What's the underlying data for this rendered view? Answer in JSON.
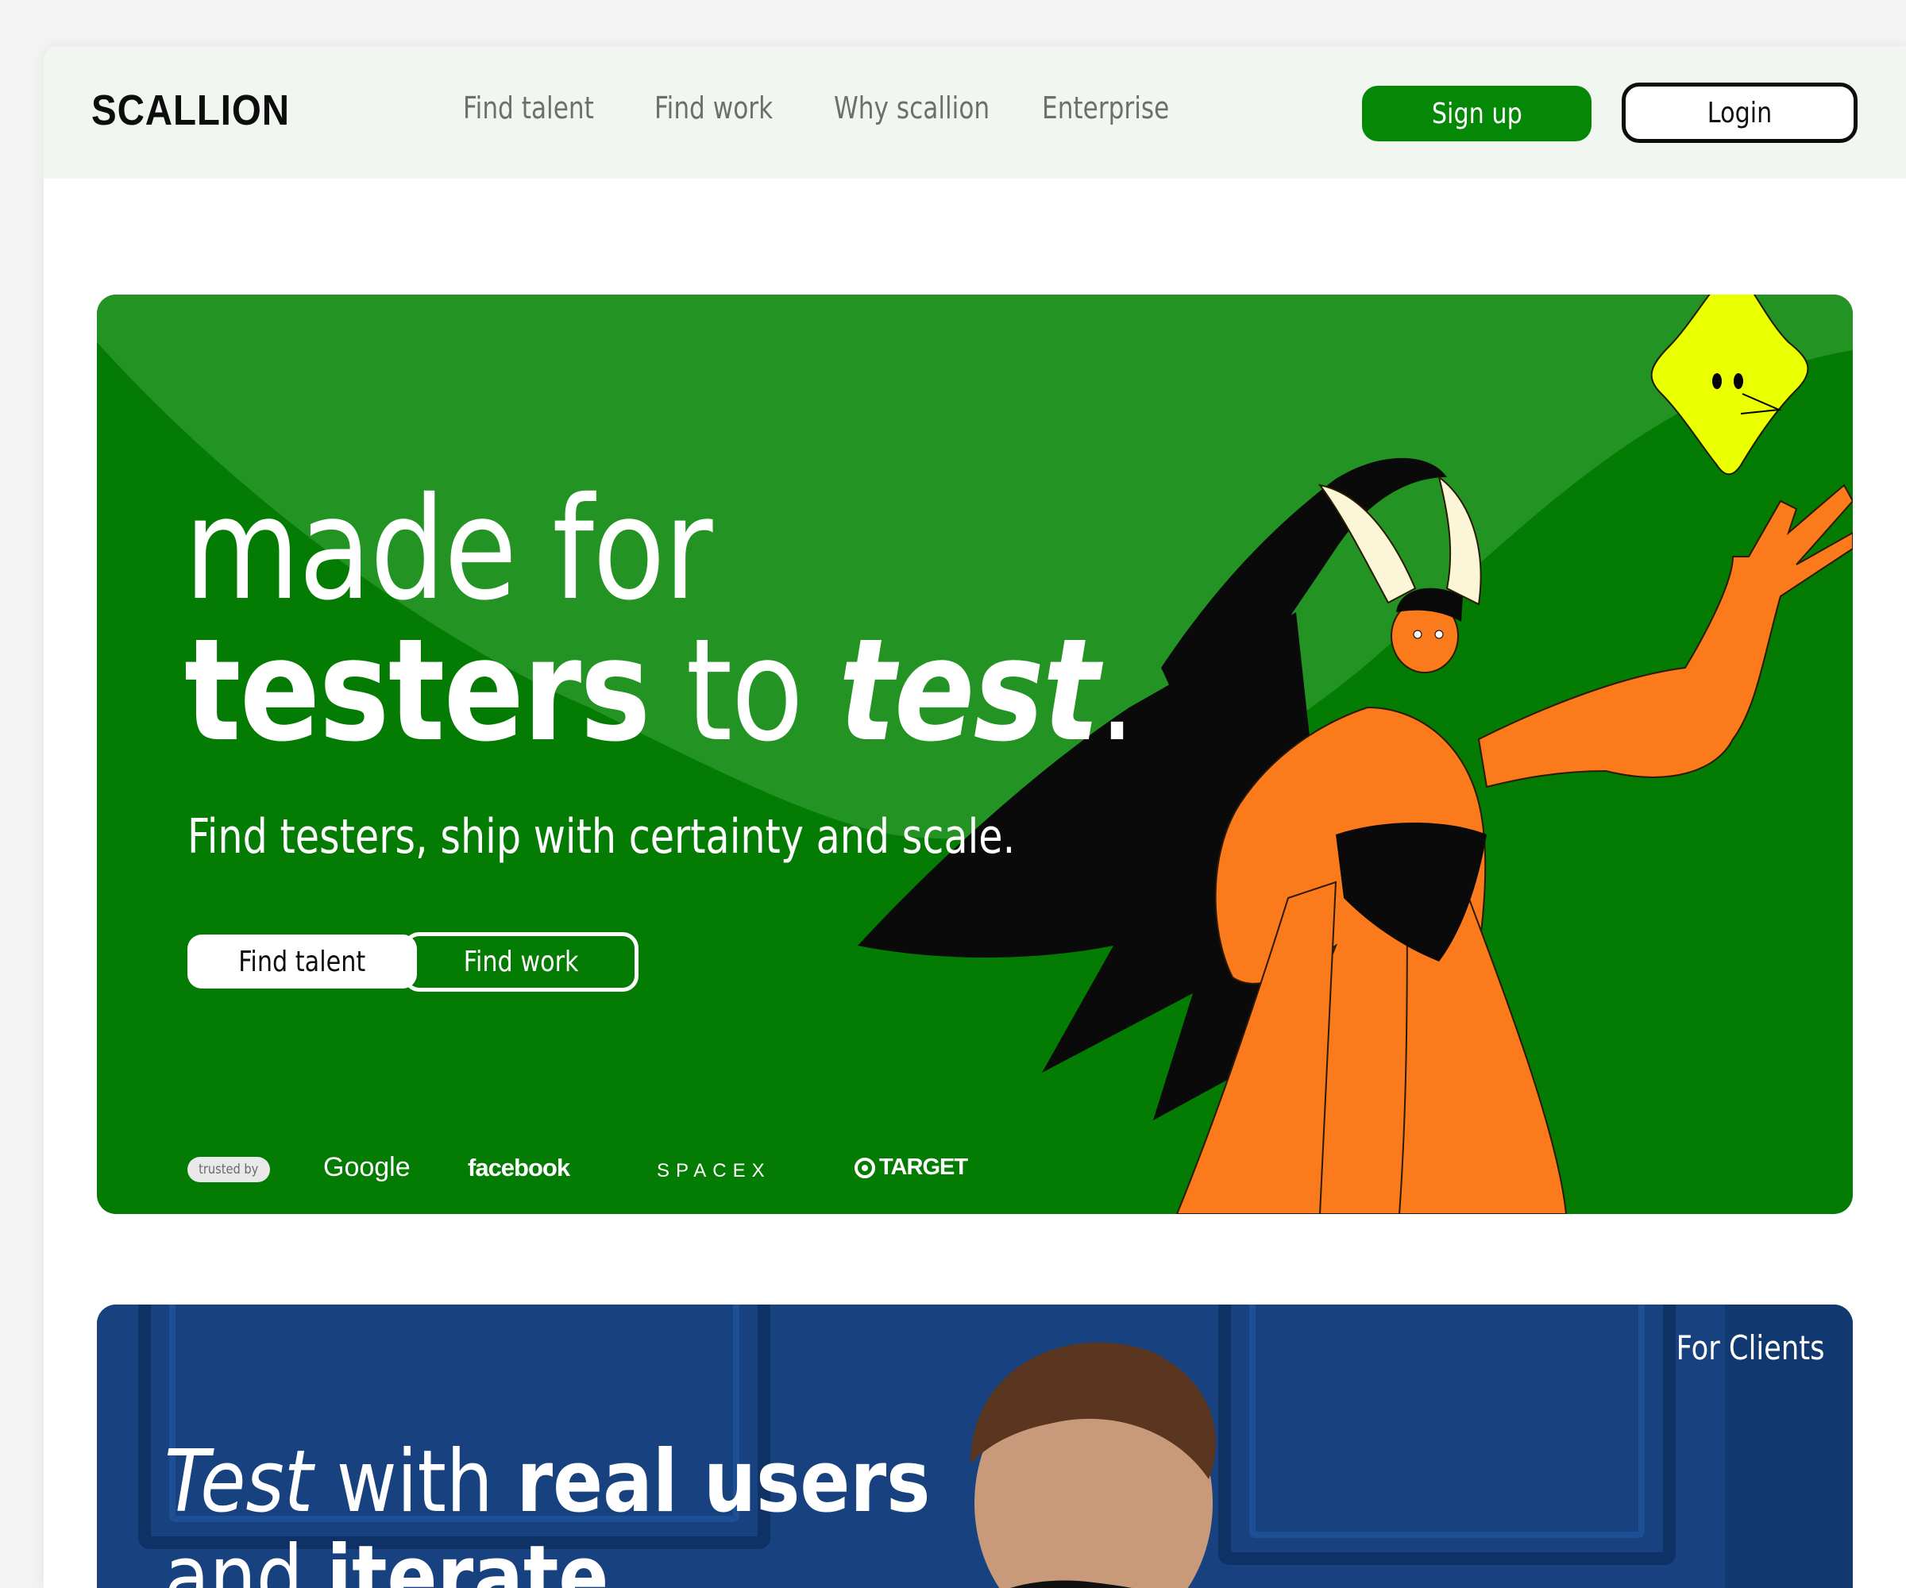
{
  "nav": {
    "logo": "SCALLION",
    "links": [
      "Find talent",
      "Find work",
      "Why scallion",
      "Enterprise"
    ],
    "signup": "Sign up",
    "login": "Login"
  },
  "hero": {
    "line1": "made for",
    "line2_bold": "testers",
    "line2_mid": " to ",
    "line2_italic": "test",
    "line2_end": ".",
    "subtitle": "Find testers, ship with certainty and scale.",
    "btn_talent": "Find talent",
    "btn_work": "Find work",
    "trusted_by": "trusted by",
    "brands": [
      "Google",
      "facebook",
      "SPACEX",
      "TARGET"
    ]
  },
  "clients": {
    "tag": "For Clients",
    "head_italic": "Test",
    "head_mid": " with ",
    "head_bold": "real users",
    "line2_plain": "and ",
    "line2_bold": "iterate"
  },
  "colors": {
    "hero_green": "#047c04",
    "signup_green": "#048805",
    "clients_blue": "#17427f",
    "character_orange": "#fb7a1c",
    "star_yellow": "#eaff00"
  }
}
